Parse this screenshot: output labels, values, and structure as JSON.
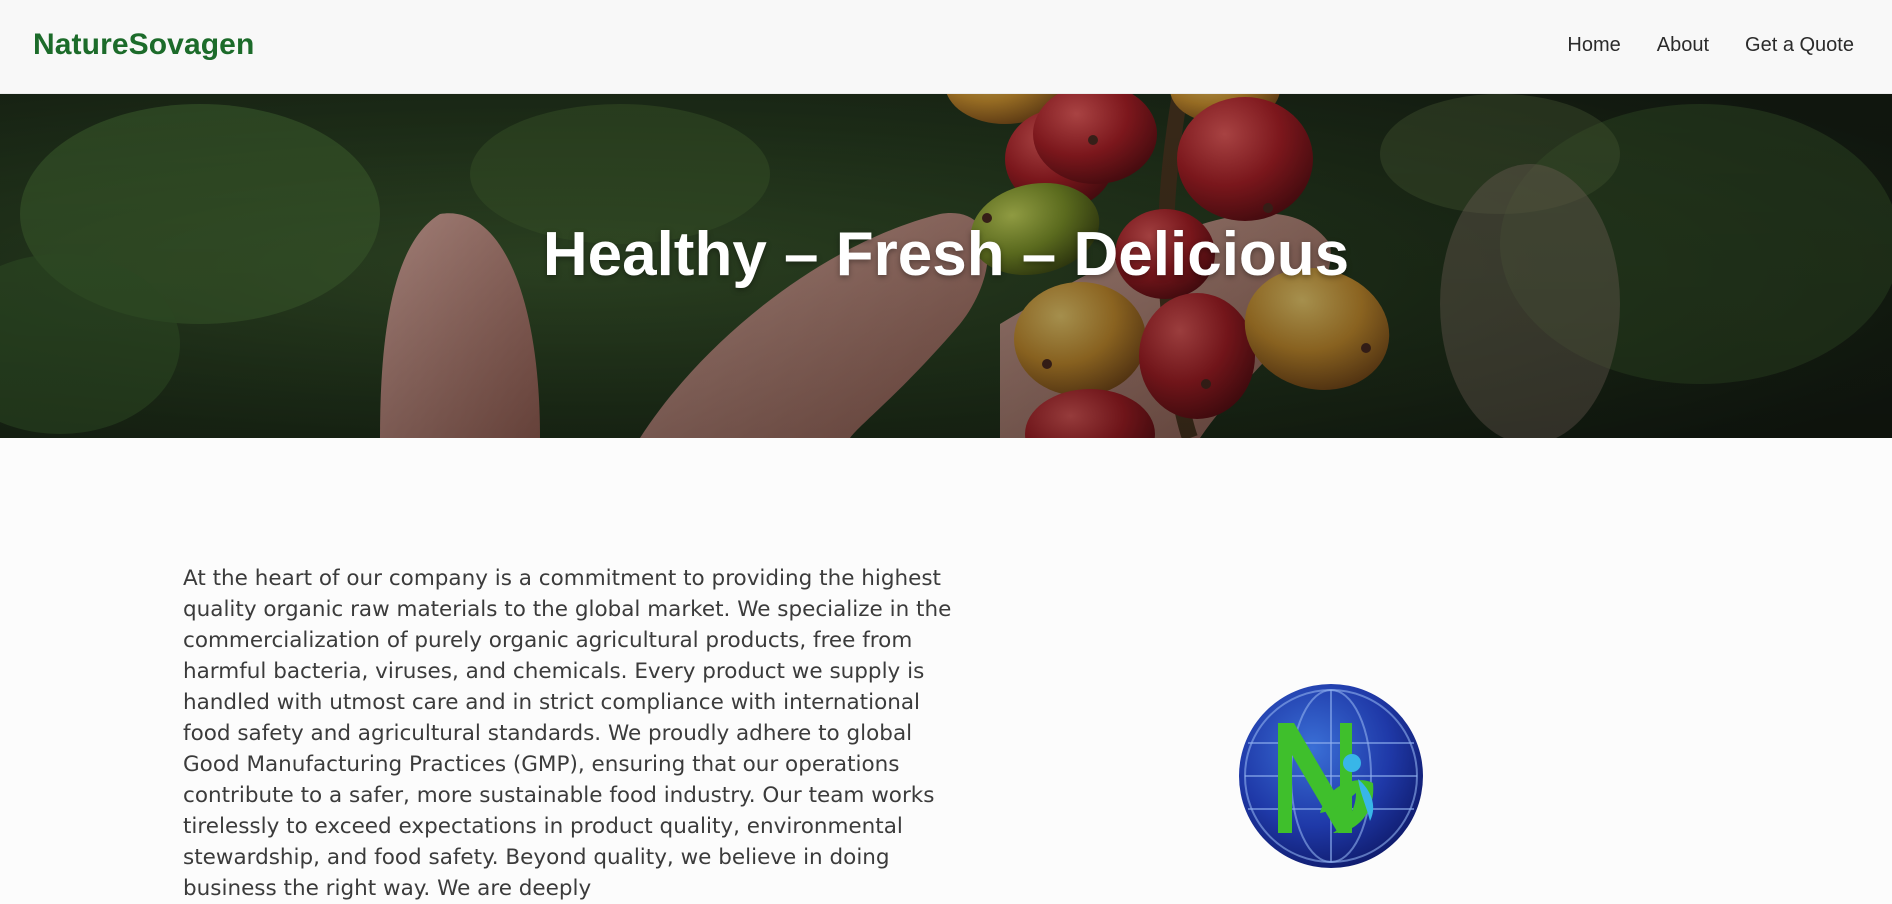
{
  "header": {
    "brand": "NatureSovagen",
    "nav": [
      {
        "label": "Home"
      },
      {
        "label": "About"
      },
      {
        "label": "Get a Quote"
      }
    ]
  },
  "hero": {
    "title": "Healthy – Fresh – Delicious"
  },
  "about": {
    "paragraph": "At the heart of our company is a commitment to providing the highest quality organic raw materials to the global market. We specialize in the commercialization of purely organic agricultural products, free from harmful bacteria, viruses, and chemicals. Every product we supply is handled with utmost care and in strict compliance with international food safety and agricultural standards. We proudly adhere to global Good Manufacturing Practices (GMP), ensuring that our operations contribute to a safer, more sustainable food industry. Our team works tirelessly to exceed expectations in product quality, environmental stewardship, and food safety. Beyond quality, we believe in doing business the right way. We are deeply"
  },
  "colors": {
    "brand": "#1c6b2a",
    "logo_blue": "#1f39a8",
    "logo_green": "#3fbf2c"
  }
}
